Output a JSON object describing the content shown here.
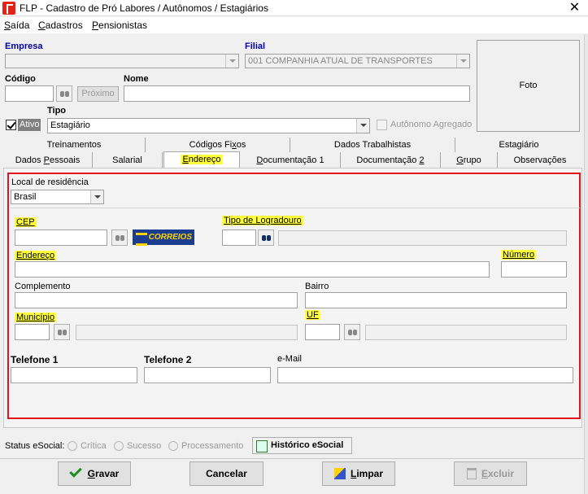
{
  "window": {
    "title": "FLP - Cadastro de Pró Labores / Autônomos / Estagiários",
    "close": "✕"
  },
  "menu": {
    "items": [
      {
        "hot": "S",
        "rest": "aída"
      },
      {
        "hot": "C",
        "rest": "adastros"
      },
      {
        "hot": "P",
        "rest": "ensionistas"
      }
    ]
  },
  "header": {
    "empresa_label": "Empresa",
    "empresa_value": "",
    "filial_label": "Filial",
    "filial_value": "001 COMPANHIA ATUAL DE TRANSPORTES",
    "codigo_label": "Código",
    "codigo_value": "",
    "proximo_label": "Próximo",
    "nome_label": "Nome",
    "nome_value": "",
    "tipo_label": "Tipo",
    "ativo_label": "Ativo",
    "ativo_checked": true,
    "tipo_value": "Estagiário",
    "autonomo_label": "Autônomo Agregado",
    "foto_label": "Foto"
  },
  "tabs": {
    "row1": [
      {
        "label": "Treinamentos",
        "hot": ""
      },
      {
        "label": "Códigos Fi",
        "hot": "x",
        "rest": "os"
      },
      {
        "label": "Dados Trabalhistas",
        "hot": ""
      },
      {
        "label": "Estagiário",
        "hot": ""
      }
    ],
    "row2": [
      {
        "pre": "Dados ",
        "hot": "P",
        "rest": "essoais"
      },
      {
        "pre": "Salarial",
        "hot": "",
        "rest": ""
      },
      {
        "pre": "",
        "hot": "E",
        "rest": "ndereço"
      },
      {
        "pre": "",
        "hot": "D",
        "rest": "ocumentação 1"
      },
      {
        "pre": "Documentação ",
        "hot": "2",
        "rest": ""
      },
      {
        "pre": "",
        "hot": "G",
        "rest": "rupo"
      },
      {
        "pre": "Observações",
        "hot": "",
        "rest": ""
      }
    ]
  },
  "endereco": {
    "local_label": "Local de residência",
    "pais_value": "Brasil",
    "cep_label": "CEP",
    "cep_value": "",
    "correios_label": "CORREIOS",
    "tipo_logradouro_label": "Tipo de Logradouro",
    "endereco_label": "Endereço",
    "numero_label": "Número",
    "complemento_label": "Complemento",
    "bairro_label": "Bairro",
    "municipio_label": "Município",
    "uf_label": "UF",
    "telefone1_label": "Telefone 1",
    "telefone2_label": "Telefone 2",
    "email_label": "e-Mail"
  },
  "status": {
    "label": "Status eSocial:",
    "options": [
      "Crítica",
      "Sucesso",
      "Processamento"
    ],
    "historico": "Histórico eSocial"
  },
  "buttons": {
    "gravar": {
      "hot": "G",
      "rest": "ravar"
    },
    "cancelar": "Cancelar",
    "limpar": {
      "hot": "L",
      "rest": "impar"
    },
    "excluir": {
      "hot": "E",
      "rest": "xcluir"
    }
  }
}
